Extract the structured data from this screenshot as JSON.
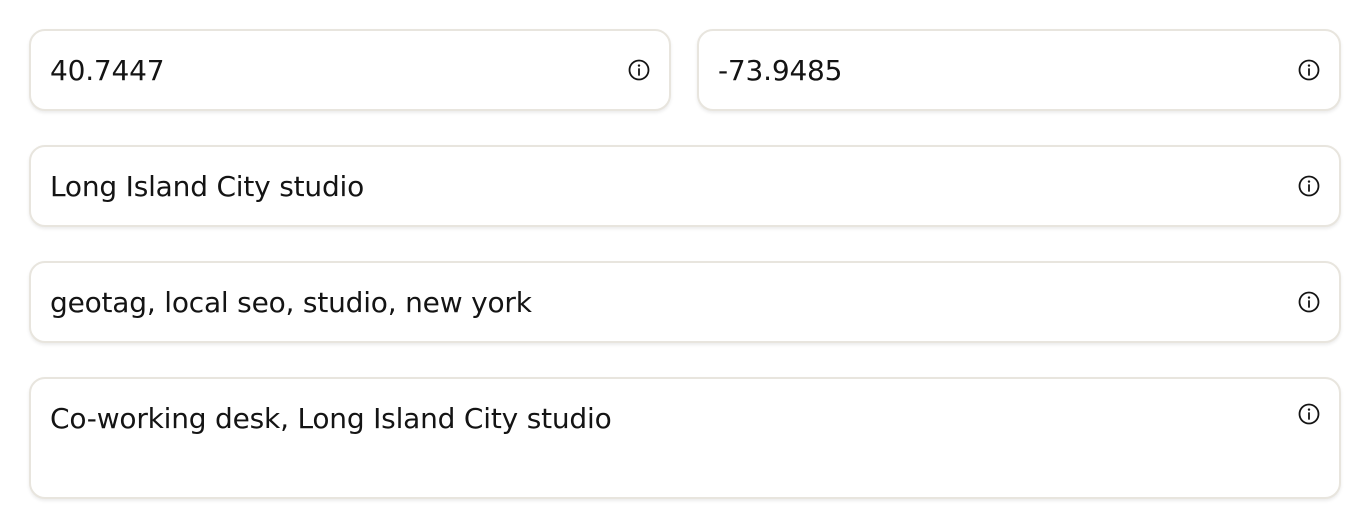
{
  "fields": {
    "latitude": {
      "value": "40.7447",
      "icon": "info-icon"
    },
    "longitude": {
      "value": "-73.9485",
      "icon": "info-icon"
    },
    "title": {
      "value": "Long Island City studio",
      "icon": "info-icon"
    },
    "keywords": {
      "value": "geotag, local seo, studio, new york",
      "icon": "info-icon"
    },
    "description": {
      "value": "Co-working desk, Long Island City studio",
      "icon": "info-icon"
    }
  },
  "colors": {
    "border": "#e8e5de",
    "text": "#141414",
    "background": "#ffffff"
  }
}
